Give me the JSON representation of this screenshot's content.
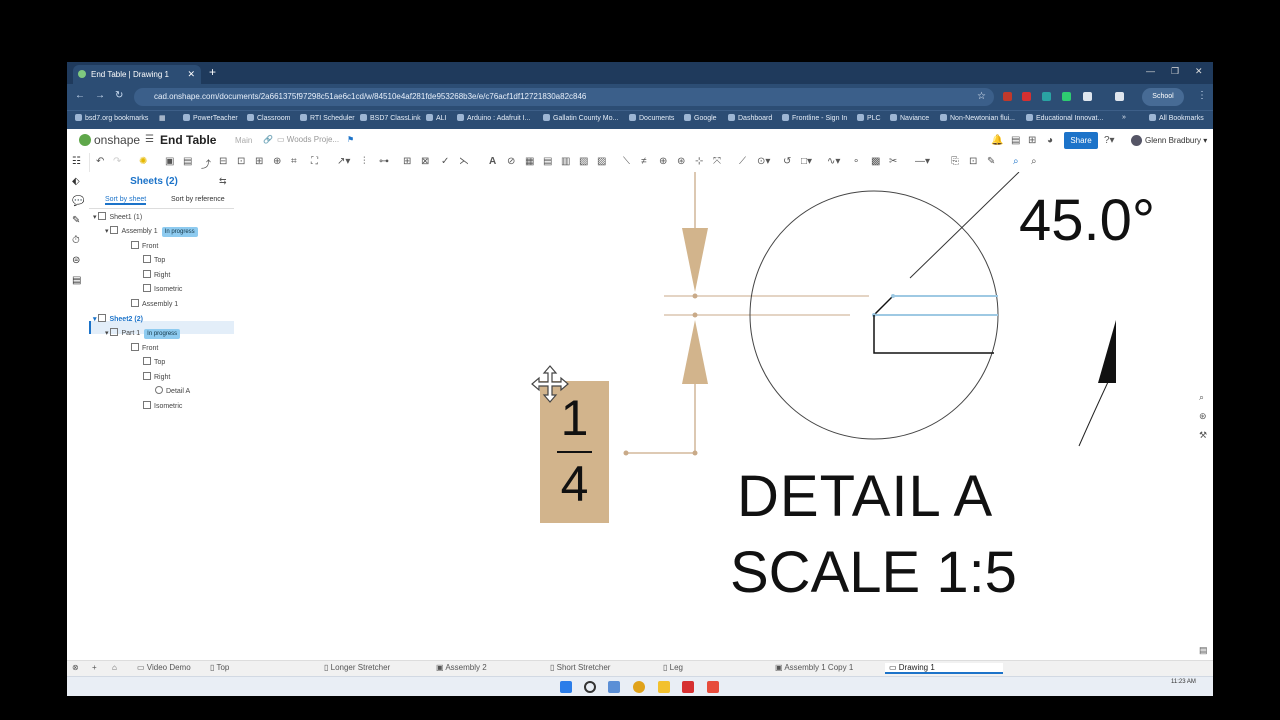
{
  "browser": {
    "tab_title": "End Table | Drawing 1",
    "new_tab": "+",
    "url": "cad.onshape.com/documents/2a661375f97298c51ae6c1cd/w/84510e4af281fde953268b3e/e/c76acf1df12721830a82c846",
    "profile_label": "School",
    "bookmarks": [
      "bsd7.org bookmarks",
      "PowerTeacher",
      "Classroom",
      "RTI Scheduler",
      "BSD7 ClassLink",
      "ALI",
      "Arduino : Adafruit I...",
      "Gallatin County Mo...",
      "Documents",
      "Google",
      "Dashboard",
      "Frontline - Sign In",
      "PLC",
      "Naviance",
      "Non-Newtonian flui...",
      "Educational Innovat...",
      "All Bookmarks"
    ]
  },
  "app": {
    "logo_text": "onshape",
    "document_title": "End Table",
    "branch": "Main",
    "folder": "Woods Proje...",
    "share_label": "Share",
    "user_name": "Glenn Bradbury"
  },
  "panel": {
    "title": "Sheets (2)",
    "sort_by_sheet": "Sort by sheet",
    "sort_by_reference": "Sort by reference",
    "tree": [
      {
        "label": "Sheet1 (1)",
        "badge": ""
      },
      {
        "label": "Assembly 1",
        "badge": "In progress"
      },
      {
        "label": "Front",
        "badge": ""
      },
      {
        "label": "Top",
        "badge": ""
      },
      {
        "label": "Right",
        "badge": ""
      },
      {
        "label": "Isometric",
        "badge": ""
      },
      {
        "label": "Assembly 1",
        "badge": ""
      },
      {
        "label": "Sheet2 (2)",
        "badge": ""
      },
      {
        "label": "Part 1",
        "badge": "In progress"
      },
      {
        "label": "Front",
        "badge": ""
      },
      {
        "label": "Top",
        "badge": ""
      },
      {
        "label": "Right",
        "badge": ""
      },
      {
        "label": "Detail A",
        "badge": ""
      },
      {
        "label": "Isometric",
        "badge": ""
      }
    ]
  },
  "drawing": {
    "angle_label": "45.0°",
    "fraction_numerator": "1",
    "fraction_denominator": "4",
    "detail_title": "DETAIL A",
    "detail_scale": "SCALE 1:5"
  },
  "sheet_tabs": [
    "Video Demo",
    "Top",
    "Longer Stretcher",
    "Assembly 2",
    "Short Stretcher",
    "Leg",
    "Assembly 1 Copy 1",
    "Drawing 1"
  ],
  "active_sheet_tab": "Drawing 1",
  "taskbar": {
    "clock": "11:23 AM"
  },
  "colors": {
    "browser_bg": "#1f3a5c",
    "accent": "#1c73c9",
    "dimension_tan": "#d2b48c",
    "selection_blue": "#8ecbf0"
  }
}
